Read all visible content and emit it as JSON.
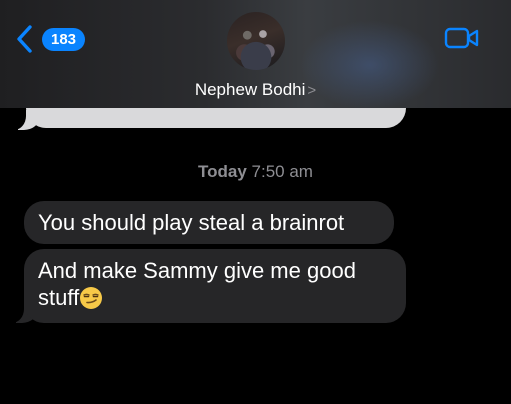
{
  "header": {
    "back_count": "183",
    "contact_name": "Nephew Bodhi",
    "name_chevron": ">",
    "icons": {
      "back": "chevron-left-icon",
      "video": "video-camera-icon",
      "avatar": "contact-photo"
    }
  },
  "conversation": {
    "timestamp_day": "Today",
    "timestamp_time": "7:50 am",
    "messages": [
      {
        "sender": "contact",
        "text": "You should play steal a brainrot"
      },
      {
        "sender": "contact",
        "text": "And make Sammy give me good stuff",
        "emoji": "smirking-face-emoji"
      }
    ]
  },
  "colors": {
    "accent": "#0a84ff",
    "received_bubble": "#262628",
    "prior_bubble": "#d9d9db",
    "timestamp": "#8e8e93",
    "background": "#000000"
  }
}
